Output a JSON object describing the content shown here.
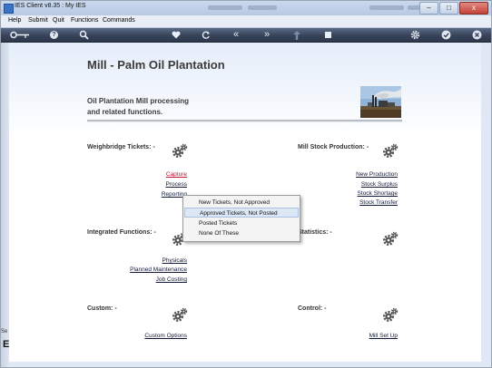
{
  "window": {
    "title": "IES Client v8.35 : My IES",
    "controls": [
      "–",
      "□",
      "x"
    ]
  },
  "menubar": [
    "Help",
    "Submit",
    "Quit",
    "Functions",
    "Commands"
  ],
  "toolbar": {
    "help": "?",
    "back": "«",
    "forward": "»"
  },
  "page": {
    "title": "Mill - Palm Oil Plantation",
    "description_line1": "Oil Plantation Mill processing",
    "description_line2": "and related functions."
  },
  "sections": {
    "weighbridge": {
      "title": "Weighbridge Tickets: -",
      "links": [
        "Capture",
        "Process",
        "Reporting"
      ]
    },
    "mill_stock": {
      "title": "Mill Stock Production: -",
      "links": [
        "New Production",
        "Stock Surplus",
        "Stock Shortage",
        "Stock Transfer"
      ]
    },
    "integrated": {
      "title": "Integrated Functions: -",
      "links": [
        "Physicals",
        "Planned Maintenance",
        "Job Costing"
      ]
    },
    "statistics": {
      "title": "Statistics: -"
    },
    "custom": {
      "title": "Custom: -",
      "links": [
        "Custom Options"
      ]
    },
    "control": {
      "title": "Control: -",
      "links": [
        "Mill Set Up"
      ]
    }
  },
  "popup_menu": {
    "items": [
      "New Tickets, Not Approved",
      "Approved Tickets, Not Posted",
      "Posted Tickets",
      "None Of These"
    ],
    "selected": "Approved Tickets, Not Posted"
  },
  "sidebar": {
    "label_small": "Se",
    "label_large": "E"
  },
  "colors": {
    "toolbar": "#374359",
    "link_active": "#c8102e",
    "link": "#10183a",
    "popup_highlight": "#dde8f7"
  }
}
